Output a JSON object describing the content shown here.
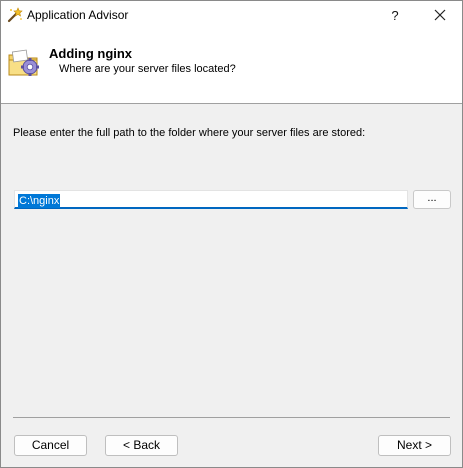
{
  "window": {
    "title": "Application Advisor",
    "help_label": "?",
    "close_label": "✕"
  },
  "header": {
    "title": "Adding nginx",
    "subtitle": "Where are your server files located?"
  },
  "main": {
    "prompt": "Please enter the full path to the folder where your server files are stored:",
    "path_value": "C:\\nginx",
    "browse_label": "..."
  },
  "footer": {
    "cancel_label": "Cancel",
    "back_label": "< Back",
    "next_label": "Next >"
  },
  "colors": {
    "accent": "#0078d7",
    "window_bg": "#f0f0f0",
    "header_bg": "#ffffff"
  },
  "icons": {
    "app": "wizard-wand-icon",
    "header": "folder-gear-icon"
  }
}
